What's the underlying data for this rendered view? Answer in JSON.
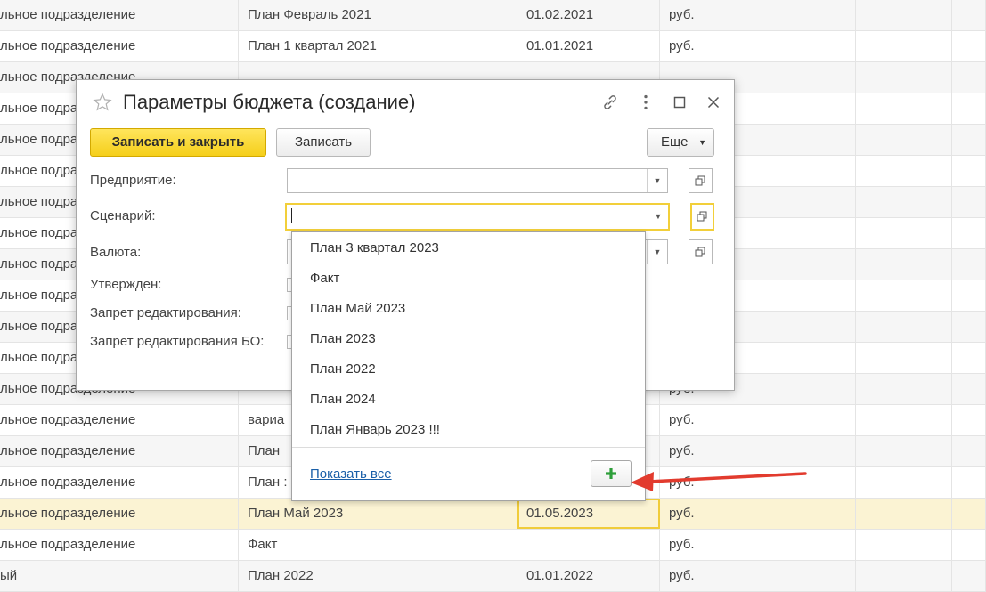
{
  "background_table": {
    "rows": [
      {
        "c0": "льное подразделение",
        "c1": "План Февраль 2021",
        "c2": "01.02.2021",
        "c3": "руб.",
        "style": "alt"
      },
      {
        "c0": "льное подразделение",
        "c1": "План 1 квартал 2021",
        "c2": "01.01.2021",
        "c3": "руб.",
        "style": ""
      },
      {
        "c0": "льное подразделение",
        "c1": "",
        "c2": "",
        "c3": "",
        "style": "alt"
      },
      {
        "c0": "льное подразделение",
        "c1": "",
        "c2": "",
        "c3": "",
        "style": ""
      },
      {
        "c0": "льное подразделение",
        "c1": "",
        "c2": "",
        "c3": "",
        "style": "alt"
      },
      {
        "c0": "льное подразделение",
        "c1": "",
        "c2": "",
        "c3": "",
        "style": ""
      },
      {
        "c0": "льное подразделение",
        "c1": "",
        "c2": "",
        "c3": "",
        "style": "alt"
      },
      {
        "c0": "льное подразделение",
        "c1": "",
        "c2": "",
        "c3": "",
        "style": ""
      },
      {
        "c0": "льное подразделение",
        "c1": "",
        "c2": "",
        "c3": "",
        "style": "alt"
      },
      {
        "c0": "льное подразделение",
        "c1": "",
        "c2": "",
        "c3": "",
        "style": ""
      },
      {
        "c0": "льное подразделение",
        "c1": "",
        "c2": "",
        "c3": "",
        "style": "alt"
      },
      {
        "c0": "льное подразделение",
        "c1": "",
        "c2": "",
        "c3": "",
        "style": ""
      },
      {
        "c0": "льное подразделение",
        "c1": "",
        "c2": "",
        "c3": "руб.",
        "style": "alt"
      },
      {
        "c0": "льное подразделение",
        "c1": "вариа",
        "c2": "",
        "c3": "руб.",
        "style": ""
      },
      {
        "c0": "льное подразделение",
        "c1": "План",
        "c2": "",
        "c3": "руб.",
        "style": "alt"
      },
      {
        "c0": "льное подразделение",
        "c1": "План :",
        "c2": "",
        "c3": "руб.",
        "style": ""
      },
      {
        "c0": "льное подразделение",
        "c1": "План Май 2023",
        "c2": "01.05.2023",
        "c3": "руб.",
        "style": "selected"
      },
      {
        "c0": "льное подразделение",
        "c1": "Факт",
        "c2": "",
        "c3": "руб.",
        "style": ""
      },
      {
        "c0": "ый",
        "c1": "План 2022",
        "c2": "01.01.2022",
        "c3": "руб.",
        "style": "alt"
      }
    ]
  },
  "dialog": {
    "title": "Параметры бюджета (создание)",
    "save_close_label": "Записать и закрыть",
    "save_label": "Записать",
    "more_label": "Еще",
    "labels": {
      "enterprise": "Предприятие:",
      "scenario": "Сценарий:",
      "currency": "Валюта:",
      "approved": "Утвержден:",
      "edit_ban": "Запрет редактирования:",
      "edit_ban_bo": "Запрет редактирования БО:"
    },
    "values": {
      "enterprise": "",
      "scenario": ""
    }
  },
  "dropdown": {
    "items": [
      "План 3 квартал 2023",
      "Факт",
      "План Май 2023",
      "План 2023",
      "План 2022",
      "План 2024",
      "План Январь 2023 !!!"
    ],
    "show_all_label": "Показать все"
  },
  "colors": {
    "accent_yellow": "#f5cf1a",
    "add_plus_green": "#2e9e3a",
    "arrow_red": "#e23b2e",
    "link_blue": "#1a5fa8"
  }
}
